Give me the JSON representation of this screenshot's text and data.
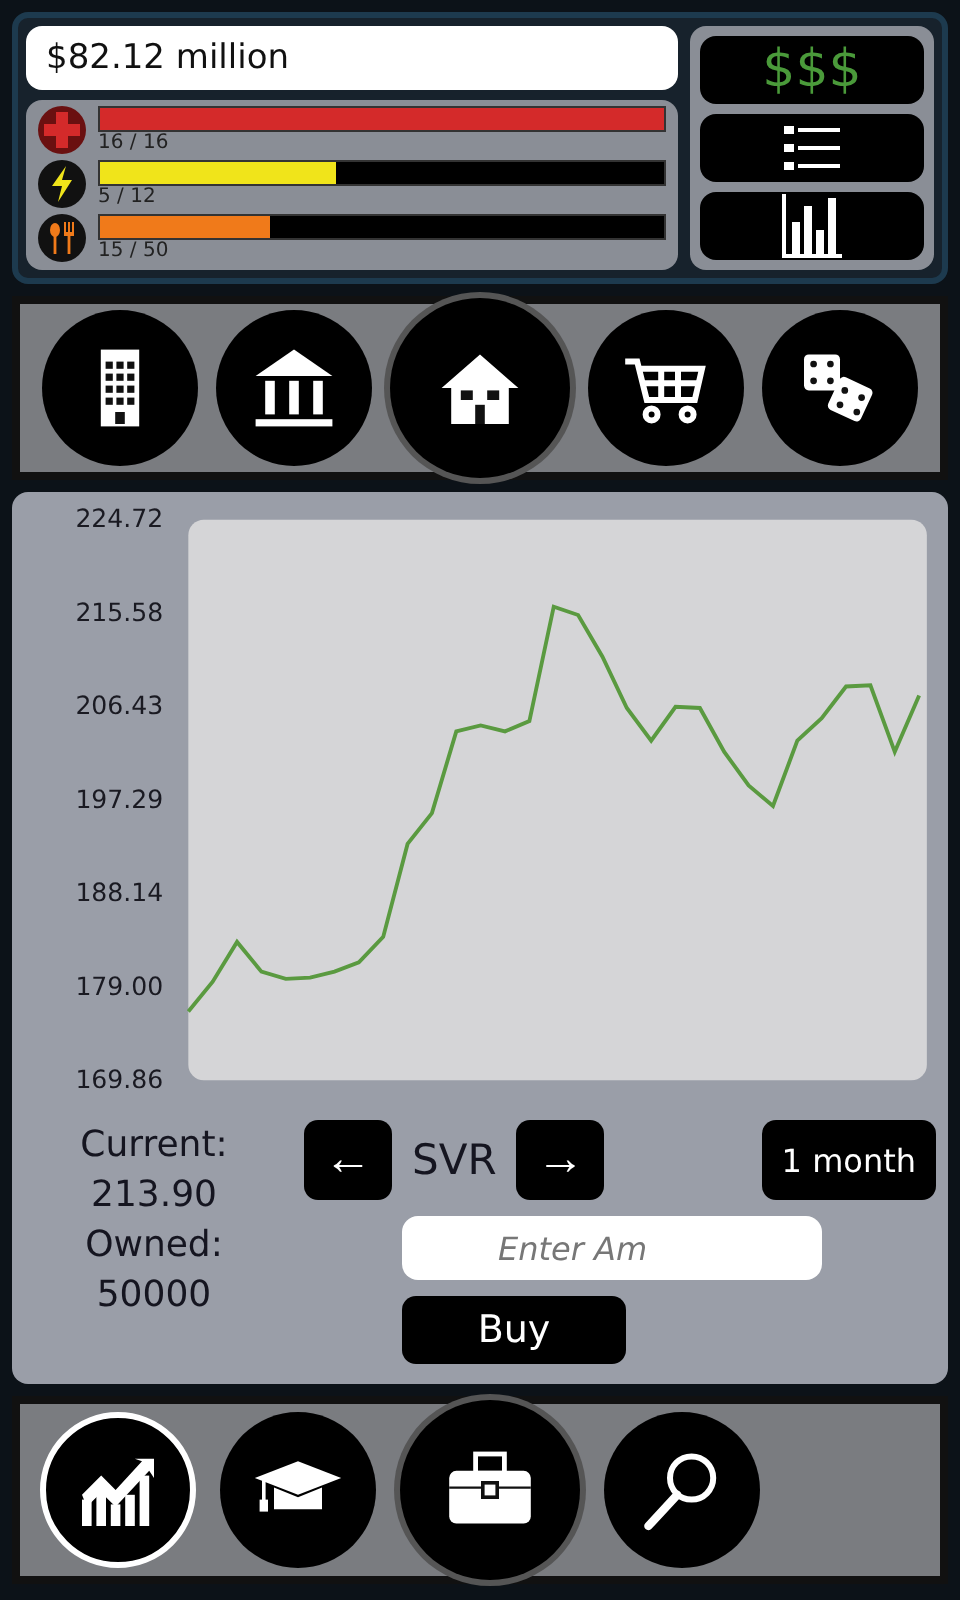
{
  "balance": "$82.12 million",
  "stats": [
    {
      "kind": "health",
      "color": "#d42a2a",
      "level": 1,
      "reading": "16 / 16"
    },
    {
      "kind": "energy",
      "color": "#f0e41a",
      "level": 0.42,
      "reading": "5 / 12"
    },
    {
      "kind": "food",
      "color": "#f07a1a",
      "level": 0.3,
      "reading": "15 / 50"
    }
  ],
  "side_buttons": [
    {
      "kind": "money",
      "label": "$$$"
    },
    {
      "kind": "list"
    },
    {
      "kind": "stats"
    }
  ],
  "top_nav": [
    {
      "kind": "office",
      "selected": false
    },
    {
      "kind": "bank",
      "selected": false
    },
    {
      "kind": "house",
      "selected": true
    },
    {
      "kind": "cart",
      "selected": false
    },
    {
      "kind": "dice",
      "selected": false
    }
  ],
  "stock": {
    "chart_data": {
      "type": "line",
      "yticks": [
        169.86,
        {
          "value": 179.0,
          "label": "179.00"
        },
        188.14,
        197.29,
        206.43,
        215.58,
        224.72
      ],
      "ylim": [
        169.86,
        224.72
      ],
      "series": [
        {
          "color": "#5a9a40",
          "values": [
            176.6,
            179.5,
            183.4,
            180.5,
            179.8,
            179.9,
            180.5,
            181.4,
            183.9,
            193.0,
            196.0,
            204.0,
            204.6,
            204.0,
            205.0,
            216.2,
            215.4,
            211.3,
            206.3,
            203.1,
            206.4,
            206.3,
            202.0,
            198.7,
            196.7,
            203.1,
            205.3,
            208.4,
            208.5,
            202.0,
            207.5
          ]
        }
      ]
    },
    "current_label": "Current:",
    "current_value": "213.90",
    "owned_label": "Owned:",
    "owned_value": "50000",
    "prev_symbol": "←",
    "symbol": "SVR",
    "next_symbol": "→",
    "period": "1 month",
    "amount_placeholder": "Enter Am",
    "buy": "Buy"
  },
  "bottom_nav": [
    {
      "kind": "growth",
      "selected": false,
      "outlined": true
    },
    {
      "kind": "education",
      "selected": false,
      "outlined": false
    },
    {
      "kind": "briefcase",
      "selected": true,
      "outlined": false
    },
    {
      "kind": "search",
      "selected": false,
      "outlined": false
    }
  ]
}
